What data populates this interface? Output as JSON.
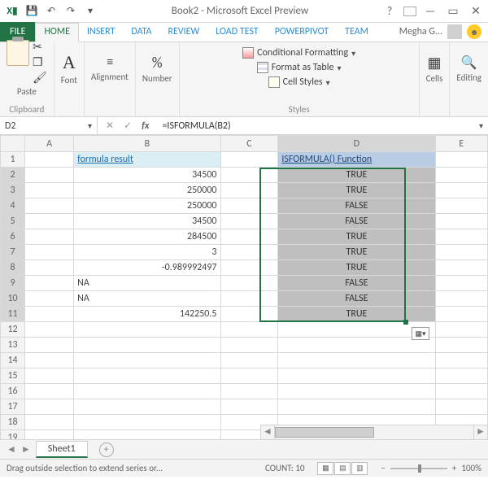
{
  "title": "Book2 - Microsoft Excel Preview",
  "qat": {
    "save": "💾",
    "undo": "↶",
    "redo": "↷"
  },
  "tabs": {
    "file": "FILE",
    "home": "HOME",
    "insert": "INSERT",
    "data": "DATA",
    "review": "REVIEW",
    "loadtest": "LOAD TEST",
    "powerpivot": "POWERPIVOT",
    "team": "TEAM"
  },
  "user": "Megha G...",
  "ribbon": {
    "paste": "Paste",
    "clipboard": "Clipboard",
    "font": "Font",
    "bold": "A",
    "alignment": "Alignment",
    "number": "Number",
    "pct": "%",
    "cond": "Conditional Formatting",
    "fmt_table": "Format as Table",
    "cell_styles": "Cell Styles",
    "styles": "Styles",
    "cells": "Cells",
    "editing": "Editing"
  },
  "namebox": "D2",
  "formula": "=ISFORMULA(B2)",
  "cols": [
    "A",
    "B",
    "C",
    "D",
    "E"
  ],
  "headers": {
    "b1": "formula result",
    "d1": "ISFORMULA() Function"
  },
  "rows": [
    {
      "b": "34500",
      "d": "TRUE"
    },
    {
      "b": "250000",
      "d": "TRUE"
    },
    {
      "b": "250000",
      "d": "FALSE"
    },
    {
      "b": "34500",
      "d": "FALSE"
    },
    {
      "b": "284500",
      "d": "TRUE"
    },
    {
      "b": "3",
      "d": "TRUE"
    },
    {
      "b": "-0.989992497",
      "d": "TRUE"
    },
    {
      "b": "NA",
      "d": "FALSE"
    },
    {
      "b": "NA",
      "d": "FALSE"
    },
    {
      "b": "142250.5",
      "d": "TRUE"
    }
  ],
  "sheet": "Sheet1",
  "status": {
    "msg": "Drag outside selection to extend series or...",
    "count": "COUNT: 10",
    "zoom": "100%"
  },
  "chart_data": {
    "type": "table",
    "title": "ISFORMULA() Function",
    "columns": [
      "formula result",
      "ISFORMULA() Function"
    ],
    "rows": [
      [
        34500,
        true
      ],
      [
        250000,
        true
      ],
      [
        250000,
        false
      ],
      [
        34500,
        false
      ],
      [
        284500,
        true
      ],
      [
        3,
        true
      ],
      [
        -0.989992497,
        true
      ],
      [
        "NA",
        false
      ],
      [
        "NA",
        false
      ],
      [
        142250.5,
        true
      ]
    ]
  }
}
